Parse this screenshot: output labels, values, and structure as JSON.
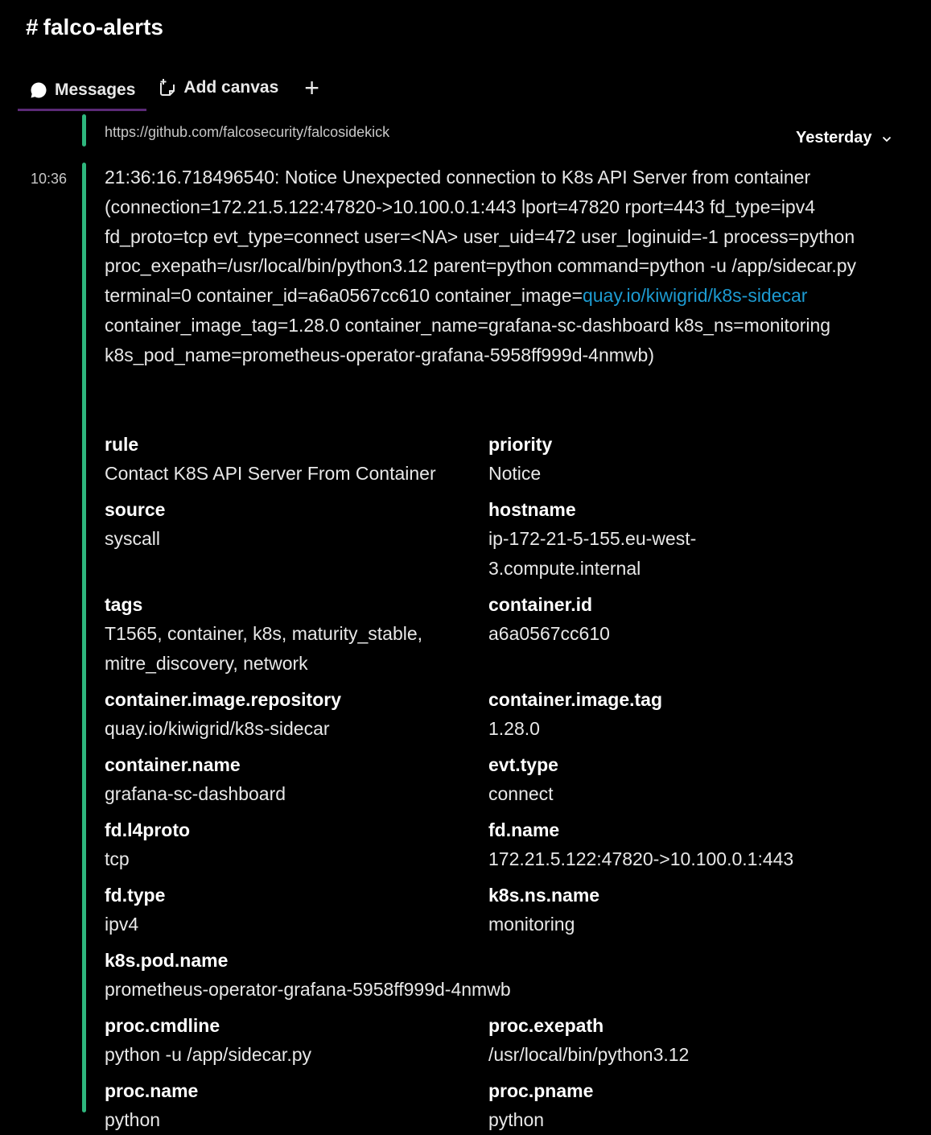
{
  "channel": {
    "hash": "#",
    "name": "falco-alerts"
  },
  "tabs": [
    {
      "label": "Messages",
      "icon": "message-bubble-icon"
    },
    {
      "label": "Add canvas",
      "icon": "canvas-icon"
    }
  ],
  "add_tab_label": "+",
  "prev_message_url": "https://github.com/falcosecurity/falcosidekick",
  "date_divider": {
    "label": "Yesterday"
  },
  "message": {
    "time": "10:36",
    "text_before_link": "21:36:16.718496540: Notice Unexpected connection to K8s API Server from container (connection=172.21.5.122:47820->10.100.0.1:443 lport=47820 rport=443 fd_type=ipv4 fd_proto=tcp evt_type=connect user=<NA> user_uid=472 user_loginuid=-1 process=python proc_exepath=/usr/local/bin/python3.12 parent=python command=python -u /app/sidecar.py terminal=0 container_id=a6a0567cc610 container_image=",
    "text_link": "quay.io/kiwigrid/k8s-sidecar",
    "text_after_link": " container_image_tag=1.28.0 container_name=grafana-sc-dashboard k8s_ns=monitoring k8s_pod_name=prometheus-operator-grafana-5958ff999d-4nmwb)"
  },
  "fields": {
    "rule": {
      "name": "rule",
      "value": "Contact K8S API Server From Container"
    },
    "priority": {
      "name": "priority",
      "value": "Notice"
    },
    "source": {
      "name": "source",
      "value": "syscall"
    },
    "hostname": {
      "name": "hostname",
      "value": "ip-172-21-5-155.eu-west-3.compute.internal"
    },
    "tags": {
      "name": "tags",
      "value": "T1565, container, k8s, maturity_stable, mitre_discovery, network"
    },
    "container_id": {
      "name": "container.id",
      "value": "a6a0567cc610"
    },
    "container_image_repository": {
      "name": "container.image.repository",
      "value": "quay.io/kiwigrid/k8s-sidecar"
    },
    "container_image_tag": {
      "name": "container.image.tag",
      "value": "1.28.0"
    },
    "container_name": {
      "name": "container.name",
      "value": "grafana-sc-dashboard"
    },
    "evt_type": {
      "name": "evt.type",
      "value": "connect"
    },
    "fd_l4proto": {
      "name": "fd.l4proto",
      "value": "tcp"
    },
    "fd_name": {
      "name": "fd.name",
      "value": "172.21.5.122:47820->10.100.0.1:443"
    },
    "fd_type": {
      "name": "fd.type",
      "value": "ipv4"
    },
    "k8s_ns_name": {
      "name": "k8s.ns.name",
      "value": "monitoring"
    },
    "k8s_pod_name": {
      "name": "k8s.pod.name",
      "value": "prometheus-operator-grafana-5958ff999d-4nmwb"
    },
    "proc_cmdline": {
      "name": "proc.cmdline",
      "value": "python -u /app/sidecar.py"
    },
    "proc_exepath": {
      "name": "proc.exepath",
      "value": "/usr/local/bin/python3.12"
    },
    "proc_name": {
      "name": "proc.name",
      "value": "python"
    },
    "proc_pname": {
      "name": "proc.pname",
      "value": "python"
    }
  },
  "colors": {
    "accent_rail": "#2eb67d",
    "link": "#1d9bd1",
    "tab_underline": "#5b2a77",
    "background": "#000000"
  }
}
